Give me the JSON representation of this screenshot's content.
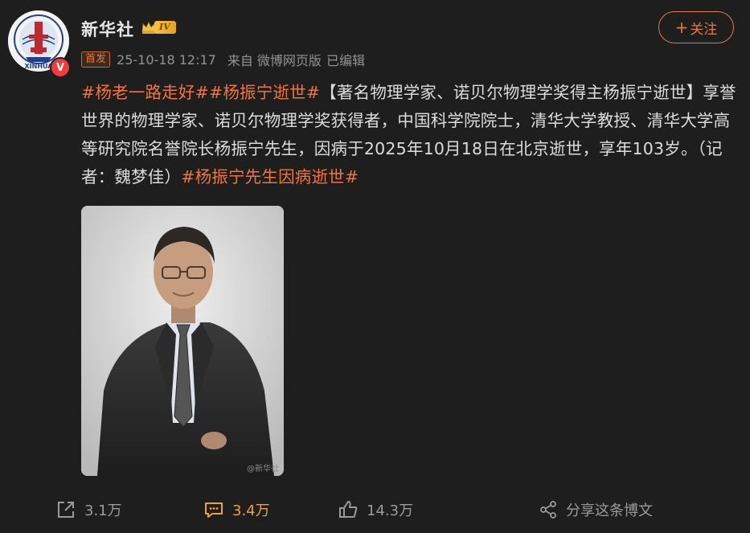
{
  "post": {
    "author": "新华社",
    "level_badge": "IV",
    "verified_badge": "V",
    "avatar_text": "XINHUA",
    "tag": "首发",
    "time": "25-10-18 12:17",
    "source": "来自 微博网页版",
    "edited": "已编辑",
    "follow_label": "关注",
    "follow_plus": "+",
    "content": {
      "hashtag1": "#杨老一路走好#",
      "hashtag2": "#杨振宁逝世#",
      "body": "【著名物理学家、诺贝尔物理学奖得主杨振宁逝世】享誉世界的物理学家、诺贝尔物理学奖获得者，中国科学院院士，清华大学教授、清华大学高等研究院名誉院长杨振宁先生，因病于2025年10月18日在北京逝世，享年103岁。（记者：魏梦佳）",
      "hashtag3": "#杨振宁先生因病逝世#"
    },
    "image_watermark": "@新华社"
  },
  "actions": {
    "repost_count": "3.1万",
    "comment_count": "3.4万",
    "like_count": "14.3万",
    "share_label": "分享这条博文"
  },
  "colors": {
    "background": "#1e1e1e",
    "accent": "#f0753a",
    "muted": "#939393"
  }
}
